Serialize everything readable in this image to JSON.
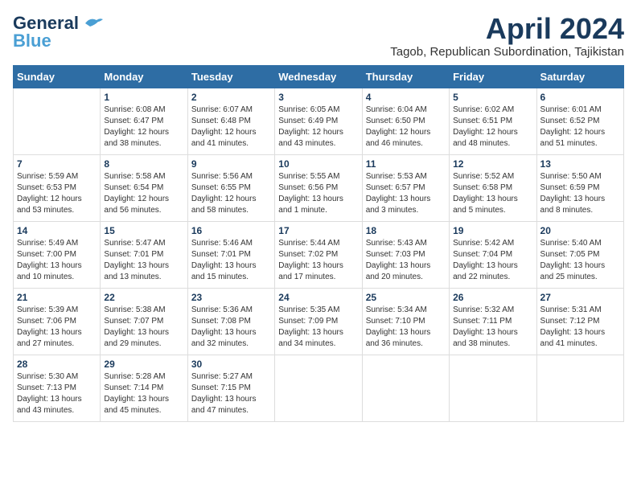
{
  "header": {
    "logo_general": "General",
    "logo_blue": "Blue",
    "month_year": "April 2024",
    "location": "Tagob, Republican Subordination, Tajikistan"
  },
  "weekdays": [
    "Sunday",
    "Monday",
    "Tuesday",
    "Wednesday",
    "Thursday",
    "Friday",
    "Saturday"
  ],
  "weeks": [
    [
      {
        "day": "",
        "sunrise": "",
        "sunset": "",
        "daylight": ""
      },
      {
        "day": "1",
        "sunrise": "6:08 AM",
        "sunset": "6:47 PM",
        "daylight": "12 hours and 38 minutes."
      },
      {
        "day": "2",
        "sunrise": "6:07 AM",
        "sunset": "6:48 PM",
        "daylight": "12 hours and 41 minutes."
      },
      {
        "day": "3",
        "sunrise": "6:05 AM",
        "sunset": "6:49 PM",
        "daylight": "12 hours and 43 minutes."
      },
      {
        "day": "4",
        "sunrise": "6:04 AM",
        "sunset": "6:50 PM",
        "daylight": "12 hours and 46 minutes."
      },
      {
        "day": "5",
        "sunrise": "6:02 AM",
        "sunset": "6:51 PM",
        "daylight": "12 hours and 48 minutes."
      },
      {
        "day": "6",
        "sunrise": "6:01 AM",
        "sunset": "6:52 PM",
        "daylight": "12 hours and 51 minutes."
      }
    ],
    [
      {
        "day": "7",
        "sunrise": "5:59 AM",
        "sunset": "6:53 PM",
        "daylight": "12 hours and 53 minutes."
      },
      {
        "day": "8",
        "sunrise": "5:58 AM",
        "sunset": "6:54 PM",
        "daylight": "12 hours and 56 minutes."
      },
      {
        "day": "9",
        "sunrise": "5:56 AM",
        "sunset": "6:55 PM",
        "daylight": "12 hours and 58 minutes."
      },
      {
        "day": "10",
        "sunrise": "5:55 AM",
        "sunset": "6:56 PM",
        "daylight": "13 hours and 1 minute."
      },
      {
        "day": "11",
        "sunrise": "5:53 AM",
        "sunset": "6:57 PM",
        "daylight": "13 hours and 3 minutes."
      },
      {
        "day": "12",
        "sunrise": "5:52 AM",
        "sunset": "6:58 PM",
        "daylight": "13 hours and 5 minutes."
      },
      {
        "day": "13",
        "sunrise": "5:50 AM",
        "sunset": "6:59 PM",
        "daylight": "13 hours and 8 minutes."
      }
    ],
    [
      {
        "day": "14",
        "sunrise": "5:49 AM",
        "sunset": "7:00 PM",
        "daylight": "13 hours and 10 minutes."
      },
      {
        "day": "15",
        "sunrise": "5:47 AM",
        "sunset": "7:01 PM",
        "daylight": "13 hours and 13 minutes."
      },
      {
        "day": "16",
        "sunrise": "5:46 AM",
        "sunset": "7:01 PM",
        "daylight": "13 hours and 15 minutes."
      },
      {
        "day": "17",
        "sunrise": "5:44 AM",
        "sunset": "7:02 PM",
        "daylight": "13 hours and 17 minutes."
      },
      {
        "day": "18",
        "sunrise": "5:43 AM",
        "sunset": "7:03 PM",
        "daylight": "13 hours and 20 minutes."
      },
      {
        "day": "19",
        "sunrise": "5:42 AM",
        "sunset": "7:04 PM",
        "daylight": "13 hours and 22 minutes."
      },
      {
        "day": "20",
        "sunrise": "5:40 AM",
        "sunset": "7:05 PM",
        "daylight": "13 hours and 25 minutes."
      }
    ],
    [
      {
        "day": "21",
        "sunrise": "5:39 AM",
        "sunset": "7:06 PM",
        "daylight": "13 hours and 27 minutes."
      },
      {
        "day": "22",
        "sunrise": "5:38 AM",
        "sunset": "7:07 PM",
        "daylight": "13 hours and 29 minutes."
      },
      {
        "day": "23",
        "sunrise": "5:36 AM",
        "sunset": "7:08 PM",
        "daylight": "13 hours and 32 minutes."
      },
      {
        "day": "24",
        "sunrise": "5:35 AM",
        "sunset": "7:09 PM",
        "daylight": "13 hours and 34 minutes."
      },
      {
        "day": "25",
        "sunrise": "5:34 AM",
        "sunset": "7:10 PM",
        "daylight": "13 hours and 36 minutes."
      },
      {
        "day": "26",
        "sunrise": "5:32 AM",
        "sunset": "7:11 PM",
        "daylight": "13 hours and 38 minutes."
      },
      {
        "day": "27",
        "sunrise": "5:31 AM",
        "sunset": "7:12 PM",
        "daylight": "13 hours and 41 minutes."
      }
    ],
    [
      {
        "day": "28",
        "sunrise": "5:30 AM",
        "sunset": "7:13 PM",
        "daylight": "13 hours and 43 minutes."
      },
      {
        "day": "29",
        "sunrise": "5:28 AM",
        "sunset": "7:14 PM",
        "daylight": "13 hours and 45 minutes."
      },
      {
        "day": "30",
        "sunrise": "5:27 AM",
        "sunset": "7:15 PM",
        "daylight": "13 hours and 47 minutes."
      },
      {
        "day": "",
        "sunrise": "",
        "sunset": "",
        "daylight": ""
      },
      {
        "day": "",
        "sunrise": "",
        "sunset": "",
        "daylight": ""
      },
      {
        "day": "",
        "sunrise": "",
        "sunset": "",
        "daylight": ""
      },
      {
        "day": "",
        "sunrise": "",
        "sunset": "",
        "daylight": ""
      }
    ]
  ]
}
